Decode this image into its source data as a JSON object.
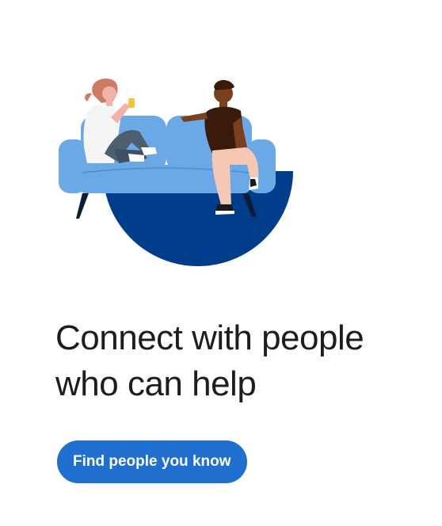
{
  "hero": {
    "illustration": "two-people-on-couch-illustration",
    "headline_line1": "Connect with people",
    "headline_line2": "who can help"
  },
  "cta": {
    "label": "Find people you know"
  },
  "colors": {
    "couch": "#6aa9e6",
    "circle": "#003e8c",
    "button": "#1f6fcf",
    "text": "#1d1d1d"
  }
}
